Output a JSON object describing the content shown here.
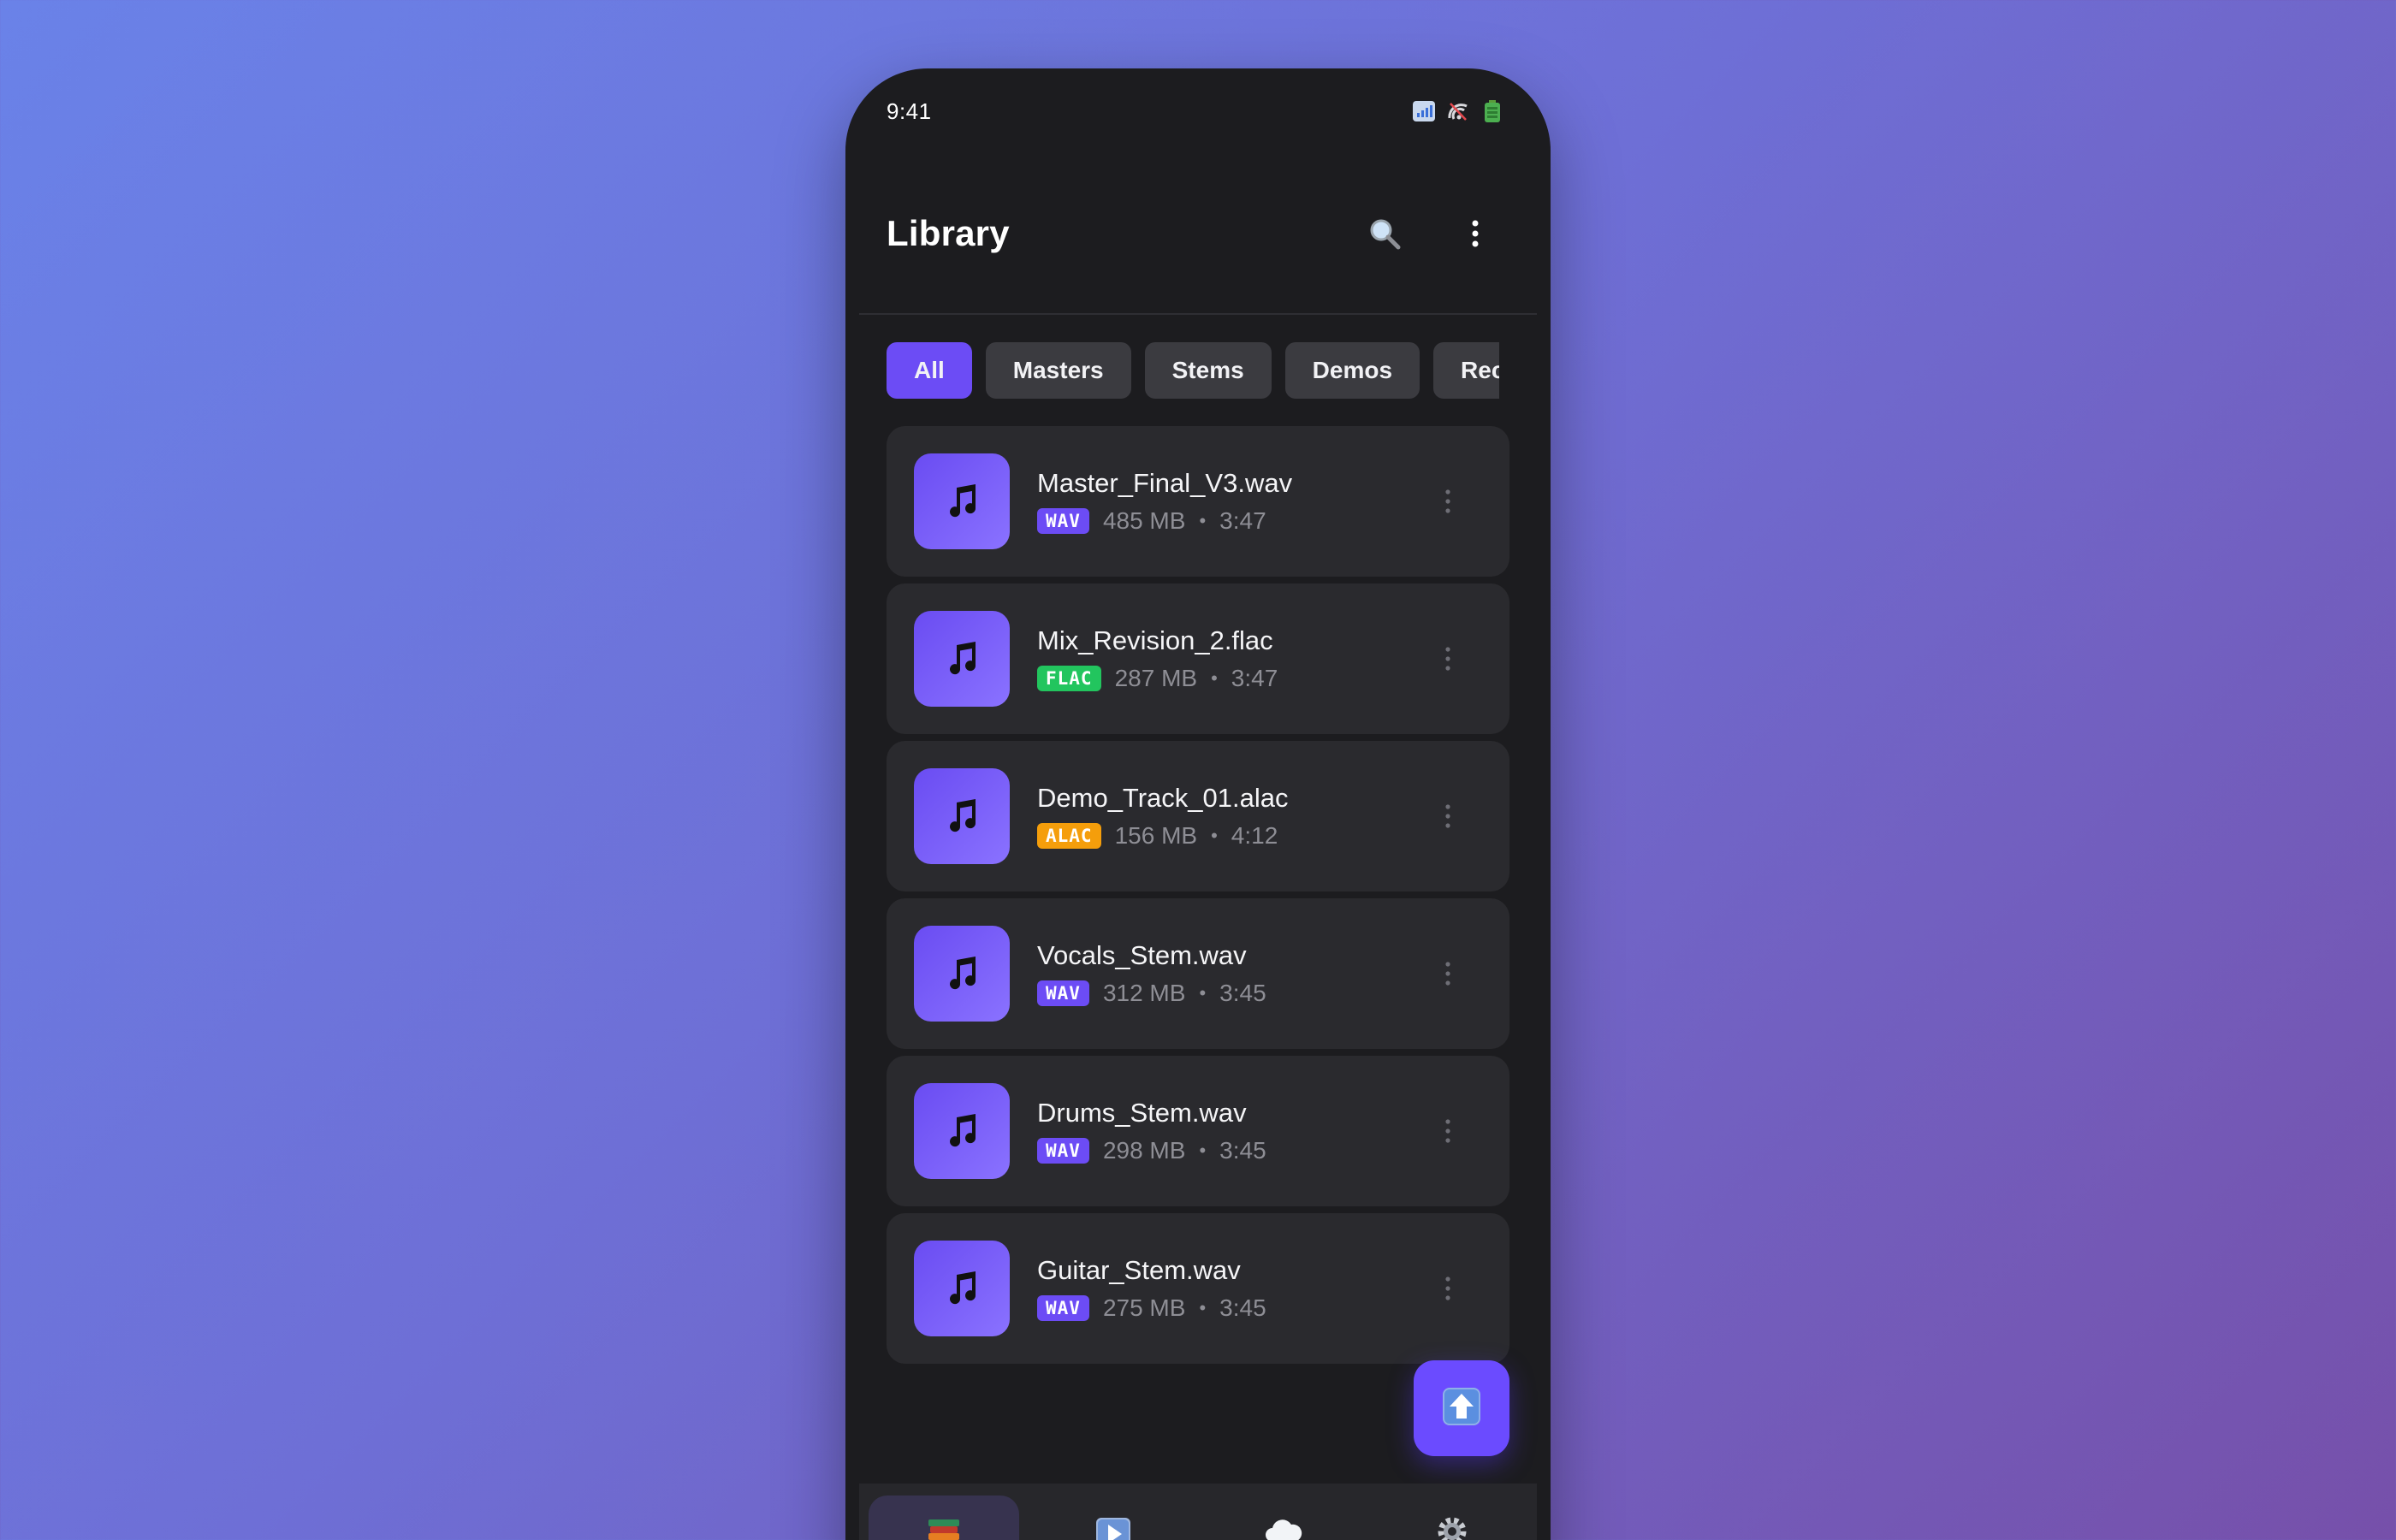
{
  "status_bar": {
    "time": "9:41",
    "icons": [
      "signal-icon",
      "wifi-off-icon",
      "battery-icon"
    ]
  },
  "header": {
    "title": "Library",
    "actions": [
      "search-icon",
      "more-vertical-icon"
    ]
  },
  "filters": {
    "chips": [
      {
        "label": "All",
        "active": true
      },
      {
        "label": "Masters",
        "active": false
      },
      {
        "label": "Stems",
        "active": false
      },
      {
        "label": "Demos",
        "active": false
      },
      {
        "label": "Rece",
        "active": false
      }
    ]
  },
  "files": [
    {
      "name": "Master_Final_V3.wav",
      "format": "WAV",
      "format_color": "#6c4cf5",
      "size": "485 MB",
      "duration": "3:47"
    },
    {
      "name": "Mix_Revision_2.flac",
      "format": "FLAC",
      "format_color": "#22c55e",
      "size": "287 MB",
      "duration": "3:47"
    },
    {
      "name": "Demo_Track_01.alac",
      "format": "ALAC",
      "format_color": "#f59e0b",
      "size": "156 MB",
      "duration": "4:12"
    },
    {
      "name": "Vocals_Stem.wav",
      "format": "WAV",
      "format_color": "#6c4cf5",
      "size": "312 MB",
      "duration": "3:45"
    },
    {
      "name": "Drums_Stem.wav",
      "format": "WAV",
      "format_color": "#6c4cf5",
      "size": "298 MB",
      "duration": "3:45"
    },
    {
      "name": "Guitar_Stem.wav",
      "format": "WAV",
      "format_color": "#6c4cf5",
      "size": "275 MB",
      "duration": "3:45"
    }
  ],
  "meta_separator": "•",
  "fab": {
    "icon": "upload-icon"
  },
  "bottom_nav": {
    "items": [
      {
        "icon": "library-icon",
        "active": true
      },
      {
        "icon": "play-icon",
        "active": false
      },
      {
        "icon": "cloud-icon",
        "active": false
      },
      {
        "icon": "settings-icon",
        "active": false
      }
    ]
  },
  "colors": {
    "accent": "#6c4cf5",
    "background": "#1c1c1f",
    "card": "#2a2a2e"
  }
}
